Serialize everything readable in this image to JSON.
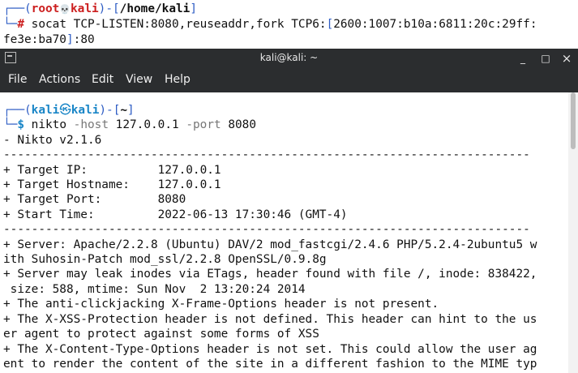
{
  "background_terminal": {
    "prompt_open": "┌──(",
    "user": "root",
    "skull": "💀",
    "host": "kali",
    "sep": ")-[",
    "dir": "/home/kali",
    "close": "]",
    "prompt2": "└─",
    "hash": "#",
    "command": "socat TCP-LISTEN:8080,reuseaddr,fork TCP6:",
    "bracket_open": "[",
    "ipv6_part1": "2600:1007:b10a:6811:20c:29ff:",
    "ipv6_part2": "fe3e:ba70",
    "bracket_close": "]",
    "port": ":80"
  },
  "window": {
    "title": "kali@kali: ~",
    "minimize": "_",
    "maximize": "□",
    "close": "×"
  },
  "menu": {
    "file": "File",
    "actions": "Actions",
    "edit": "Edit",
    "view": "View",
    "help": "Help"
  },
  "terminal": {
    "prompt_open": "┌──(",
    "user": "kali",
    "at": "㉿",
    "host": "kali",
    "sep": ")-[",
    "dir": "~",
    "close": "]",
    "prompt2": "└─",
    "dollar": "$",
    "cmd": "nikto",
    "opt_host": "-host",
    "host_val": "127.0.0.1",
    "opt_port": "-port",
    "port_val": "8080",
    "lines": [
      "- Nikto v2.1.6",
      "---------------------------------------------------------------------------",
      "+ Target IP:          127.0.0.1",
      "+ Target Hostname:    127.0.0.1",
      "+ Target Port:        8080",
      "+ Start Time:         2022-06-13 17:30:46 (GMT-4)",
      "---------------------------------------------------------------------------",
      "+ Server: Apache/2.2.8 (Ubuntu) DAV/2 mod_fastcgi/2.4.6 PHP/5.2.4-2ubuntu5 w",
      "ith Suhosin-Patch mod_ssl/2.2.8 OpenSSL/0.9.8g",
      "+ Server may leak inodes via ETags, header found with file /, inode: 838422,",
      " size: 588, mtime: Sun Nov  2 13:20:24 2014",
      "+ The anti-clickjacking X-Frame-Options header is not present.",
      "+ The X-XSS-Protection header is not defined. This header can hint to the us",
      "er agent to protect against some forms of XSS",
      "+ The X-Content-Type-Options header is not set. This could allow the user ag",
      "ent to render the content of the site in a different fashion to the MIME typ"
    ]
  }
}
